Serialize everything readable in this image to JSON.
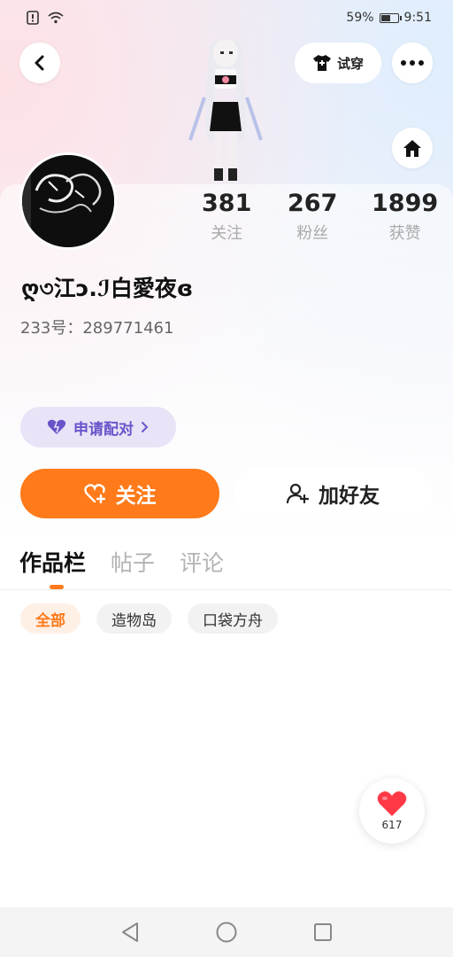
{
  "status_bar": {
    "battery": "59%",
    "battery_level": 0.59,
    "time": "9:51"
  },
  "header": {
    "try_on_label": "试穿"
  },
  "profile": {
    "name": "ღ৩江ↄ.ℐ白愛夜ɞ",
    "uid": "233号：289771461",
    "stats": [
      {
        "value": "381",
        "label": "关注"
      },
      {
        "value": "267",
        "label": "粉丝"
      },
      {
        "value": "1899",
        "label": "获赞"
      }
    ]
  },
  "actions": {
    "pair_label": "申请配对",
    "follow_label": "关注",
    "add_friend_label": "加好友"
  },
  "tabs": [
    {
      "label": "作品栏"
    },
    {
      "label": "帖子"
    },
    {
      "label": "评论"
    }
  ],
  "filters": [
    {
      "label": "全部"
    },
    {
      "label": "造物岛"
    },
    {
      "label": "口袋方舟"
    }
  ],
  "like_fab": {
    "count": "617"
  },
  "colors": {
    "accent": "#ff7a1a",
    "pair_purple": "#6a53c9",
    "like_red": "#ff3a46"
  }
}
